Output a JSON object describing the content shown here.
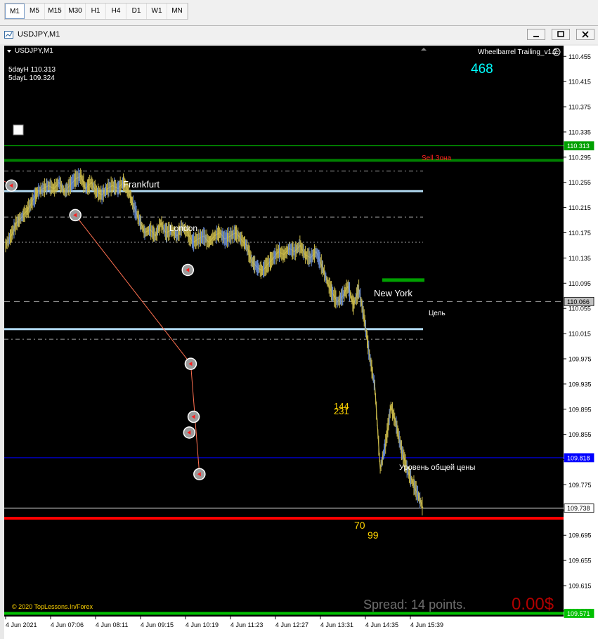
{
  "toolbar": {
    "timeframes": [
      "M1",
      "M5",
      "M15",
      "M30",
      "H1",
      "H4",
      "D1",
      "W1",
      "MN"
    ],
    "active": "M1"
  },
  "window": {
    "title": "USDJPY,M1",
    "icon": "chart-window-icon"
  },
  "chart": {
    "symbol_label": "USDJPY,M1",
    "five_day_high": "5dayH 110.313",
    "five_day_low": "5dayL 109.324",
    "indicator_name": "Wheelbarrel Trailing_v1.2",
    "counter": "468",
    "sell_zone_label": "Sell Зона",
    "target_label": "Цель",
    "general_price_label": "Уровень общей цены",
    "session_labels": [
      "Frankfurt",
      "London",
      "New York"
    ],
    "mid_numbers": [
      "144",
      "231"
    ],
    "bottom_numbers": [
      "70",
      "99"
    ],
    "copyright": "© 2020 TopLessons.In/Forex",
    "spread": "Spread: 14 points.",
    "profit": "0.00$",
    "colors": {
      "background": "#000000",
      "price_line": "#c8b84a",
      "sell_zone": "#ff2020",
      "counter": "#00ffff",
      "profit": "#b00000"
    }
  },
  "chart_data": {
    "type": "line",
    "yticks": [
      "110.455",
      "110.415",
      "110.375",
      "110.335",
      "110.295",
      "110.255",
      "110.215",
      "110.175",
      "110.135",
      "110.095",
      "110.055",
      "110.015",
      "109.975",
      "109.935",
      "109.895",
      "109.855",
      "109.815",
      "109.775",
      "109.735",
      "109.695",
      "109.655",
      "109.615",
      "109.575"
    ],
    "xticks": [
      "4 Jun 2021",
      "4 Jun 07:06",
      "4 Jun 08:11",
      "4 Jun 09:15",
      "4 Jun 10:19",
      "4 Jun 11:23",
      "4 Jun 12:27",
      "4 Jun 13:31",
      "4 Jun 14:35",
      "4 Jun 15:39"
    ],
    "price_tags": [
      {
        "label": "110.313",
        "value": 110.313,
        "color": "#00a000"
      },
      {
        "label": "110.066",
        "value": 110.066,
        "color": "#c0c0c0"
      },
      {
        "label": "109.818",
        "value": 109.818,
        "color": "#0000ff"
      },
      {
        "label": "109.738",
        "value": 109.738,
        "color": "#ffffff"
      },
      {
        "label": "109.571",
        "value": 109.571,
        "color": "#00c000"
      }
    ],
    "ylim": [
      109.566,
      110.472
    ],
    "levels": [
      {
        "value": 110.313,
        "color": "#00c000",
        "style": "solid-thin"
      },
      {
        "value": 110.29,
        "color": "#008000",
        "style": "solid-thick"
      },
      {
        "value": 110.273,
        "color": "#a0a0a0",
        "style": "dashdot"
      },
      {
        "value": 110.241,
        "color": "#b0d8f0",
        "style": "solid-medium"
      },
      {
        "value": 110.2,
        "color": "#a0a0a0",
        "style": "dashdot"
      },
      {
        "value": 110.16,
        "color": "#a0a0a0",
        "style": "dotted"
      },
      {
        "value": 110.066,
        "color": "#a0a0a0",
        "style": "dashed"
      },
      {
        "value": 110.022,
        "color": "#b0d8f0",
        "style": "solid-medium"
      },
      {
        "value": 110.006,
        "color": "#a0a0a0",
        "style": "dashdot"
      },
      {
        "value": 109.818,
        "color": "#0000ff",
        "style": "solid-thin"
      },
      {
        "value": 109.738,
        "color": "#ffffff",
        "style": "solid-thin"
      },
      {
        "value": 109.722,
        "color": "#ff0000",
        "style": "solid-thick"
      },
      {
        "value": 109.571,
        "color": "#00c000",
        "style": "solid-thick"
      }
    ],
    "price_series": [
      110.155,
      110.17,
      110.19,
      110.2,
      110.21,
      110.225,
      110.24,
      110.245,
      110.25,
      110.245,
      110.255,
      110.24,
      110.25,
      110.26,
      110.265,
      110.245,
      110.255,
      110.24,
      110.235,
      110.245,
      110.25,
      110.245,
      110.255,
      110.24,
      110.215,
      110.195,
      110.175,
      110.18,
      110.17,
      110.19,
      110.175,
      110.18,
      110.17,
      110.185,
      110.175,
      110.16,
      110.165,
      110.17,
      110.16,
      110.17,
      110.175,
      110.165,
      110.17,
      110.175,
      110.165,
      110.155,
      110.13,
      110.12,
      110.115,
      110.125,
      110.135,
      110.145,
      110.14,
      110.15,
      110.145,
      110.155,
      110.14,
      110.135,
      110.145,
      110.125,
      110.1,
      110.08,
      110.065,
      110.075,
      110.09,
      110.06,
      110.085,
      110.04,
      109.98,
      109.93,
      109.8,
      109.84,
      109.9,
      109.87,
      109.83,
      109.8,
      109.78,
      109.76,
      109.738
    ],
    "x_range_minutes": [
      0,
      575
    ],
    "trade_markers": [
      {
        "t": 8,
        "price": 110.25
      },
      {
        "t": 96,
        "price": 110.203
      },
      {
        "t": 251,
        "price": 110.116
      },
      {
        "t": 255,
        "price": 109.967
      },
      {
        "t": 253,
        "price": 109.858
      },
      {
        "t": 259,
        "price": 109.883
      },
      {
        "t": 267,
        "price": 109.792
      }
    ]
  }
}
